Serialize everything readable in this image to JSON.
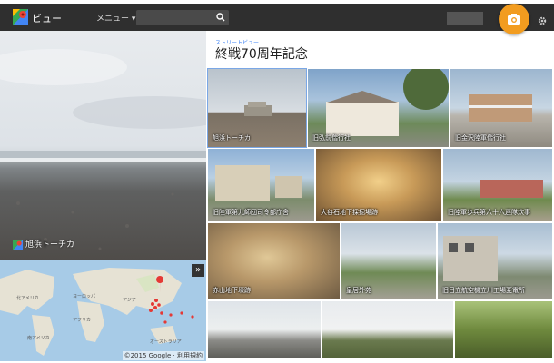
{
  "header": {
    "app_title": "ビュー",
    "menu_label": "メニュー ▾"
  },
  "panorama": {
    "label": "旭浜トーチカ"
  },
  "map": {
    "copyright": "©2015 Google · 利用規約",
    "continents": [
      "北アメリカ",
      "ヨーロッパ",
      "アジア",
      "アフリカ",
      "南アメリカ",
      "オーストラリア"
    ]
  },
  "collection": {
    "subtitle": "ストリートビュー",
    "title": "終戦70周年記念",
    "tiles": [
      {
        "label": "旭浜トーチカ"
      },
      {
        "label": "旧弘前偕行社"
      },
      {
        "label": "旧金沢陸軍偕行社"
      },
      {
        "label": "旧陸軍第九師団司令部庁舎"
      },
      {
        "label": "大谷石地下採掘場跡"
      },
      {
        "label": "旧陸軍歩兵第六十六連隊炊事"
      },
      {
        "label": "赤山地下壕跡"
      },
      {
        "label": "皇居外苑"
      },
      {
        "label": "旧日立航空機立川工場変電所"
      },
      {
        "label": ""
      },
      {
        "label": ""
      },
      {
        "label": ""
      }
    ]
  },
  "colors": {
    "accent": "#f29c1f",
    "topbar": "#2f2f2f",
    "link": "#4285f4"
  }
}
